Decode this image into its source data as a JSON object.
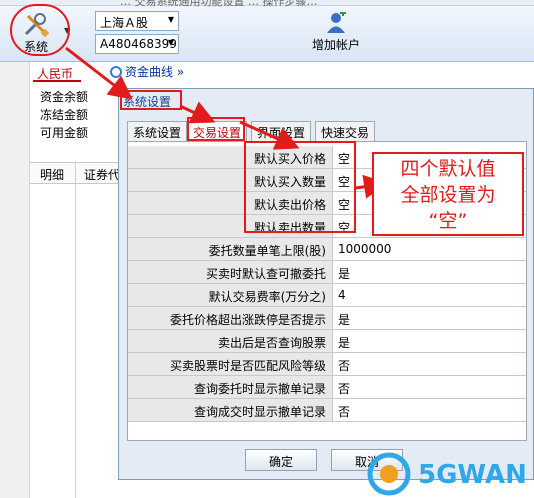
{
  "top_strip_text": "… 交易系统通用功能设置 … 操作步骤…",
  "toolbar": {
    "system_label": "系统",
    "market_select": "上海Ａ股",
    "account_select": "A480468399",
    "add_account_label": "增加帐户"
  },
  "panel": {
    "currency_tab": "人民币",
    "fund_curve": "资金曲线",
    "fund_curve_arrows": "»",
    "balances": [
      "资金余额",
      "冻结金额",
      "可用金额"
    ],
    "grid_headers": [
      "明细",
      "证券代"
    ]
  },
  "dialog": {
    "title": "系统设置",
    "tabs": [
      "系统设置",
      "交易设置",
      "界面设置",
      "快速交易"
    ],
    "active_tab_index": 1,
    "rows": [
      {
        "label": "默认买入价格",
        "value": "空"
      },
      {
        "label": "默认买入数量",
        "value": "空"
      },
      {
        "label": "默认卖出价格",
        "value": "空"
      },
      {
        "label": "默认卖出数量",
        "value": "空"
      },
      {
        "label": "委托数量单笔上限(股)",
        "value": "1000000"
      },
      {
        "label": "买卖时默认查可撤委托",
        "value": "是"
      },
      {
        "label": "默认交易费率(万分之)",
        "value": "4"
      },
      {
        "label": "委托价格超出涨跌停是否提示",
        "value": "是"
      },
      {
        "label": "卖出后是否查询股票",
        "value": "是"
      },
      {
        "label": "买卖股票时是否匹配风险等级",
        "value": "否"
      },
      {
        "label": "查询委托时显示撤单记录",
        "value": "否"
      },
      {
        "label": "查询成交时显示撤单记录",
        "value": "否"
      }
    ],
    "ok_label": "确定",
    "cancel_label": "取消"
  },
  "annotation": {
    "callout_lines": [
      "四个默认值",
      "全部设置为",
      "“空”"
    ],
    "color": "#e21b1b"
  },
  "watermark": "5GWAN"
}
